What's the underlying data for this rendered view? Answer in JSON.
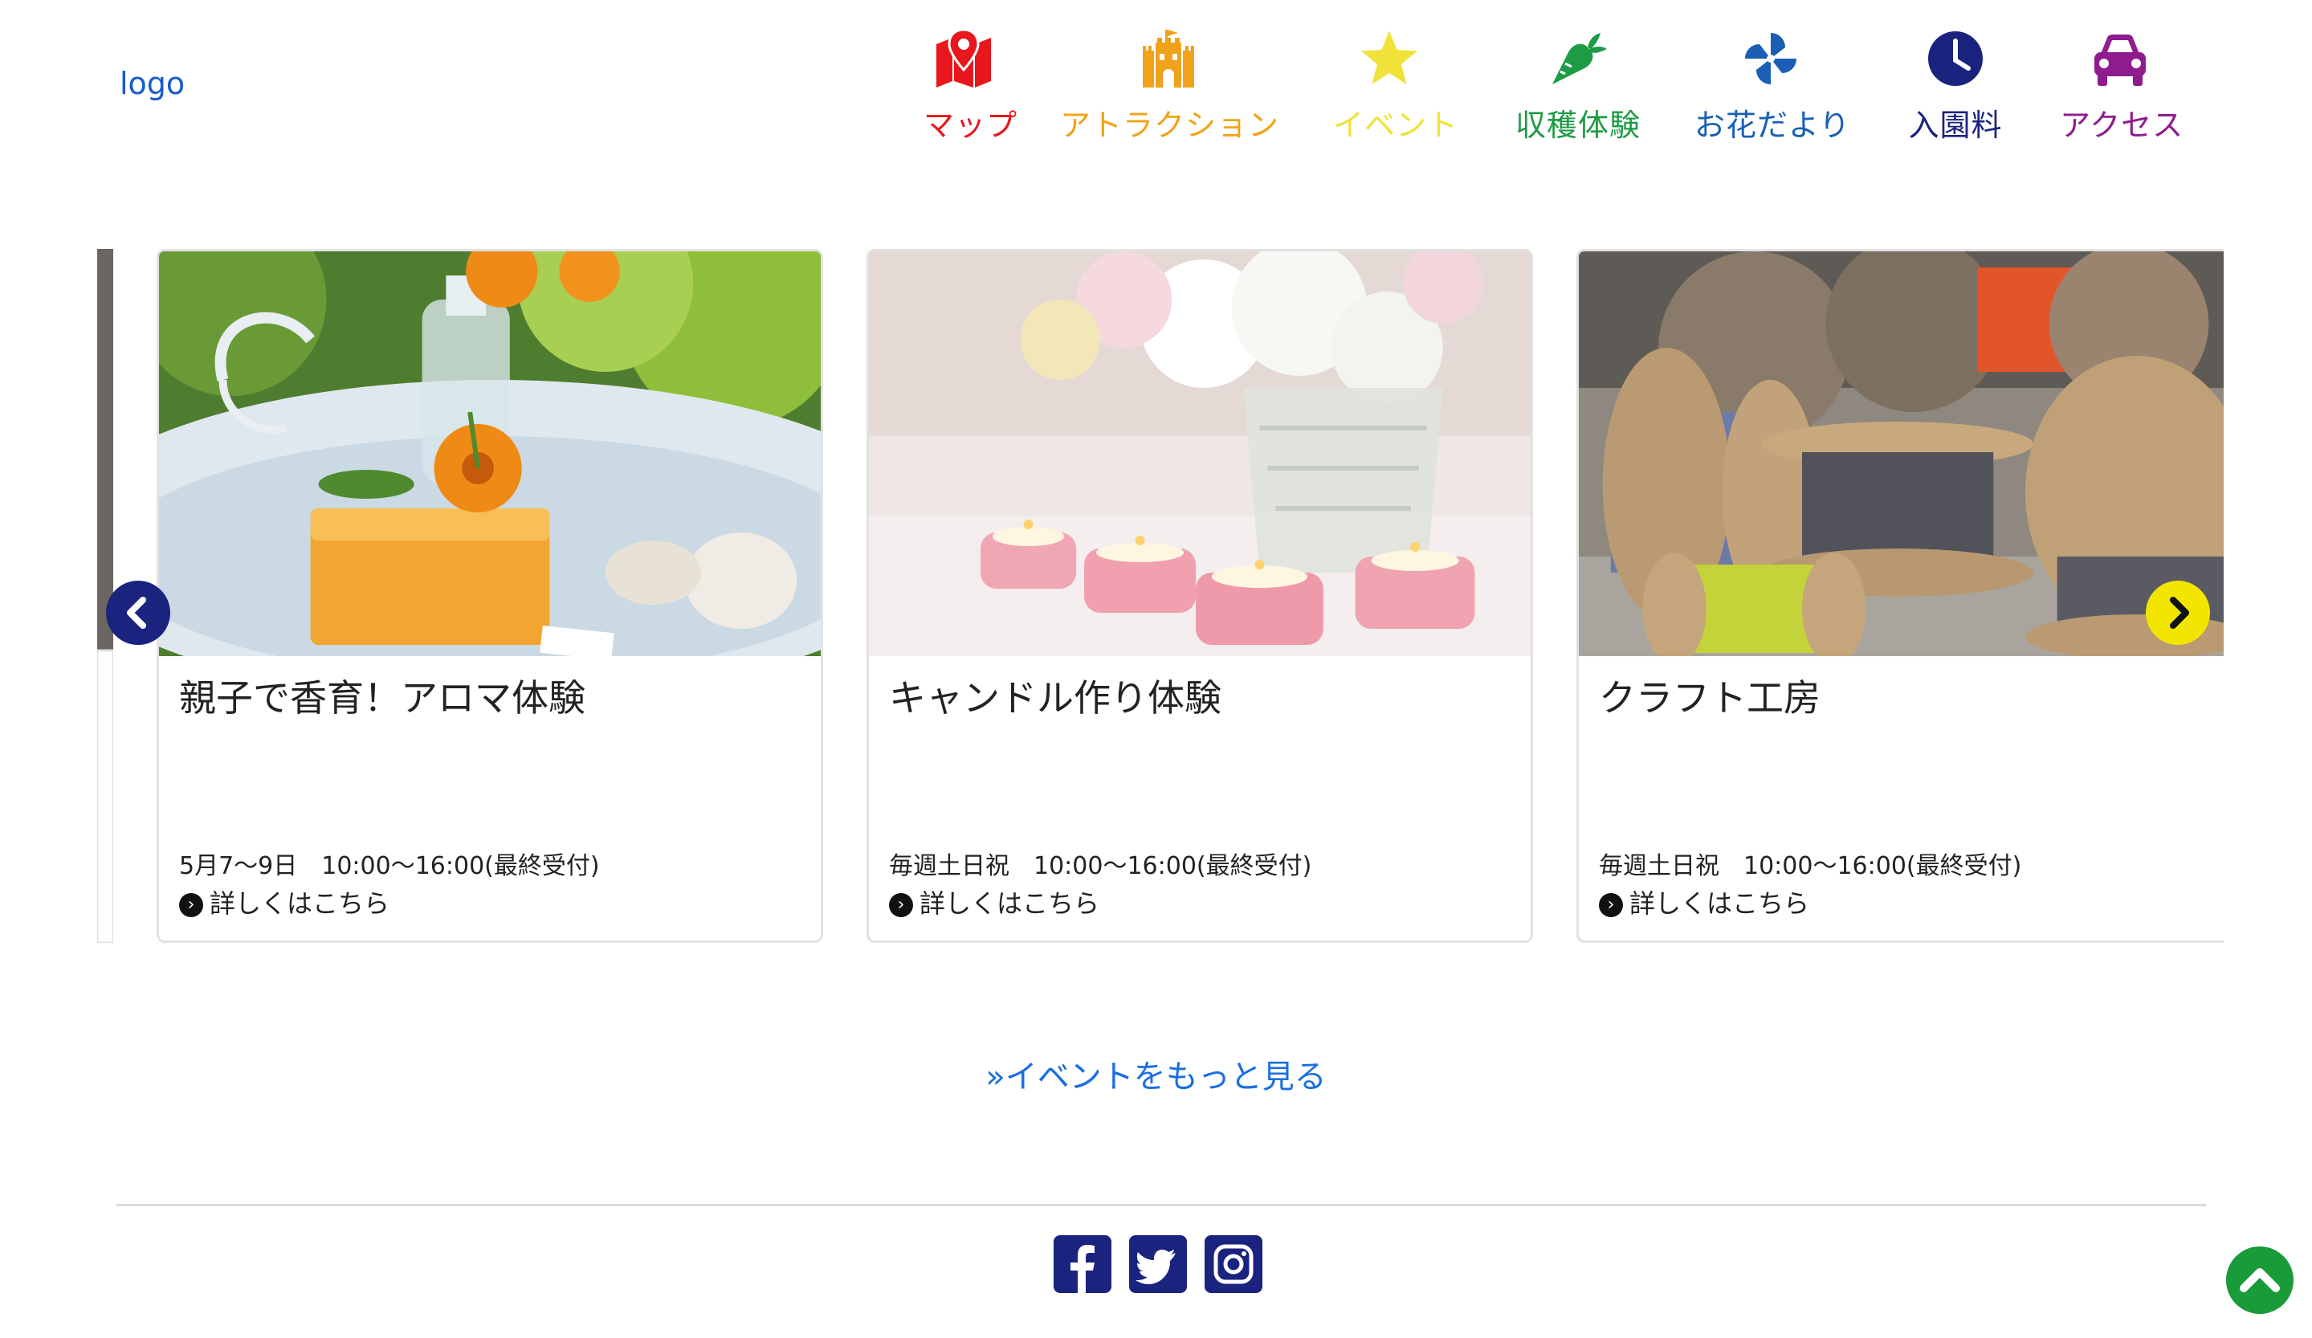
{
  "header": {
    "logo_text": "logo"
  },
  "nav": [
    {
      "label": "マップ",
      "color": "#e8171d",
      "icon": "map-pin-icon"
    },
    {
      "label": "アトラクション",
      "color": "#f0a31a",
      "icon": "castle-icon"
    },
    {
      "label": "イベント",
      "color": "#f1e23a",
      "icon": "star-icon"
    },
    {
      "label": "収穫体験",
      "color": "#1e9b45",
      "icon": "carrot-icon"
    },
    {
      "label": "お花だより",
      "color": "#1a5fb4",
      "icon": "pinwheel-icon"
    },
    {
      "label": "入園料",
      "color": "#1a237e",
      "icon": "clock-icon"
    },
    {
      "label": "アクセス",
      "color": "#8e1c8e",
      "icon": "car-icon"
    }
  ],
  "events": [
    {
      "title": "親子で香育！アロマ体験",
      "date": "5月7〜9日　10:00〜16:00(最終受付)",
      "link": "詳しくはこちら",
      "image": "aroma-soap-flower-photo"
    },
    {
      "title": "キャンドル作り体験",
      "date": "毎週土日祝　10:00〜16:00(最終受付)",
      "link": "詳しくはこちら",
      "image": "flower-vase-candles-photo"
    },
    {
      "title": "クラフト工房",
      "date": "毎週土日祝　10:00〜16:00(最終受付)",
      "link": "詳しくはこちら",
      "image": "cable-spools-photo"
    }
  ],
  "more_link": "»イベントをもっと見る",
  "social": [
    {
      "icon": "facebook-icon",
      "color": "#1a237e"
    },
    {
      "icon": "twitter-icon",
      "color": "#1a237e"
    },
    {
      "icon": "instagram-icon",
      "color": "#1a237e"
    }
  ],
  "carousel": {
    "prev_color": "#1a237e",
    "next_color": "#f2e600"
  },
  "back_to_top_color": "#1a9b3a"
}
